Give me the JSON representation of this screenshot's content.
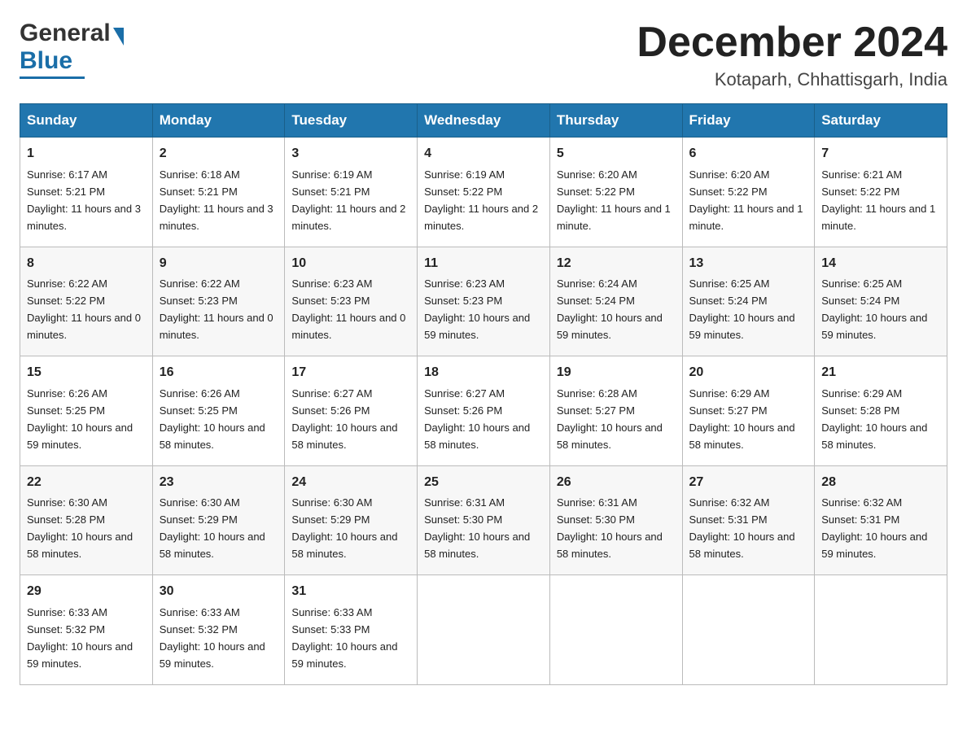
{
  "logo": {
    "name_black": "General",
    "name_blue": "Blue",
    "line_color": "#1a6ea8"
  },
  "header": {
    "title": "December 2024",
    "subtitle": "Kotaparh, Chhattisgarh, India"
  },
  "weekdays": [
    "Sunday",
    "Monday",
    "Tuesday",
    "Wednesday",
    "Thursday",
    "Friday",
    "Saturday"
  ],
  "weeks": [
    [
      {
        "day": "1",
        "sunrise": "6:17 AM",
        "sunset": "5:21 PM",
        "daylight": "11 hours and 3 minutes."
      },
      {
        "day": "2",
        "sunrise": "6:18 AM",
        "sunset": "5:21 PM",
        "daylight": "11 hours and 3 minutes."
      },
      {
        "day": "3",
        "sunrise": "6:19 AM",
        "sunset": "5:21 PM",
        "daylight": "11 hours and 2 minutes."
      },
      {
        "day": "4",
        "sunrise": "6:19 AM",
        "sunset": "5:22 PM",
        "daylight": "11 hours and 2 minutes."
      },
      {
        "day": "5",
        "sunrise": "6:20 AM",
        "sunset": "5:22 PM",
        "daylight": "11 hours and 1 minute."
      },
      {
        "day": "6",
        "sunrise": "6:20 AM",
        "sunset": "5:22 PM",
        "daylight": "11 hours and 1 minute."
      },
      {
        "day": "7",
        "sunrise": "6:21 AM",
        "sunset": "5:22 PM",
        "daylight": "11 hours and 1 minute."
      }
    ],
    [
      {
        "day": "8",
        "sunrise": "6:22 AM",
        "sunset": "5:22 PM",
        "daylight": "11 hours and 0 minutes."
      },
      {
        "day": "9",
        "sunrise": "6:22 AM",
        "sunset": "5:23 PM",
        "daylight": "11 hours and 0 minutes."
      },
      {
        "day": "10",
        "sunrise": "6:23 AM",
        "sunset": "5:23 PM",
        "daylight": "11 hours and 0 minutes."
      },
      {
        "day": "11",
        "sunrise": "6:23 AM",
        "sunset": "5:23 PM",
        "daylight": "10 hours and 59 minutes."
      },
      {
        "day": "12",
        "sunrise": "6:24 AM",
        "sunset": "5:24 PM",
        "daylight": "10 hours and 59 minutes."
      },
      {
        "day": "13",
        "sunrise": "6:25 AM",
        "sunset": "5:24 PM",
        "daylight": "10 hours and 59 minutes."
      },
      {
        "day": "14",
        "sunrise": "6:25 AM",
        "sunset": "5:24 PM",
        "daylight": "10 hours and 59 minutes."
      }
    ],
    [
      {
        "day": "15",
        "sunrise": "6:26 AM",
        "sunset": "5:25 PM",
        "daylight": "10 hours and 59 minutes."
      },
      {
        "day": "16",
        "sunrise": "6:26 AM",
        "sunset": "5:25 PM",
        "daylight": "10 hours and 58 minutes."
      },
      {
        "day": "17",
        "sunrise": "6:27 AM",
        "sunset": "5:26 PM",
        "daylight": "10 hours and 58 minutes."
      },
      {
        "day": "18",
        "sunrise": "6:27 AM",
        "sunset": "5:26 PM",
        "daylight": "10 hours and 58 minutes."
      },
      {
        "day": "19",
        "sunrise": "6:28 AM",
        "sunset": "5:27 PM",
        "daylight": "10 hours and 58 minutes."
      },
      {
        "day": "20",
        "sunrise": "6:29 AM",
        "sunset": "5:27 PM",
        "daylight": "10 hours and 58 minutes."
      },
      {
        "day": "21",
        "sunrise": "6:29 AM",
        "sunset": "5:28 PM",
        "daylight": "10 hours and 58 minutes."
      }
    ],
    [
      {
        "day": "22",
        "sunrise": "6:30 AM",
        "sunset": "5:28 PM",
        "daylight": "10 hours and 58 minutes."
      },
      {
        "day": "23",
        "sunrise": "6:30 AM",
        "sunset": "5:29 PM",
        "daylight": "10 hours and 58 minutes."
      },
      {
        "day": "24",
        "sunrise": "6:30 AM",
        "sunset": "5:29 PM",
        "daylight": "10 hours and 58 minutes."
      },
      {
        "day": "25",
        "sunrise": "6:31 AM",
        "sunset": "5:30 PM",
        "daylight": "10 hours and 58 minutes."
      },
      {
        "day": "26",
        "sunrise": "6:31 AM",
        "sunset": "5:30 PM",
        "daylight": "10 hours and 58 minutes."
      },
      {
        "day": "27",
        "sunrise": "6:32 AM",
        "sunset": "5:31 PM",
        "daylight": "10 hours and 58 minutes."
      },
      {
        "day": "28",
        "sunrise": "6:32 AM",
        "sunset": "5:31 PM",
        "daylight": "10 hours and 59 minutes."
      }
    ],
    [
      {
        "day": "29",
        "sunrise": "6:33 AM",
        "sunset": "5:32 PM",
        "daylight": "10 hours and 59 minutes."
      },
      {
        "day": "30",
        "sunrise": "6:33 AM",
        "sunset": "5:32 PM",
        "daylight": "10 hours and 59 minutes."
      },
      {
        "day": "31",
        "sunrise": "6:33 AM",
        "sunset": "5:33 PM",
        "daylight": "10 hours and 59 minutes."
      },
      null,
      null,
      null,
      null
    ]
  ]
}
